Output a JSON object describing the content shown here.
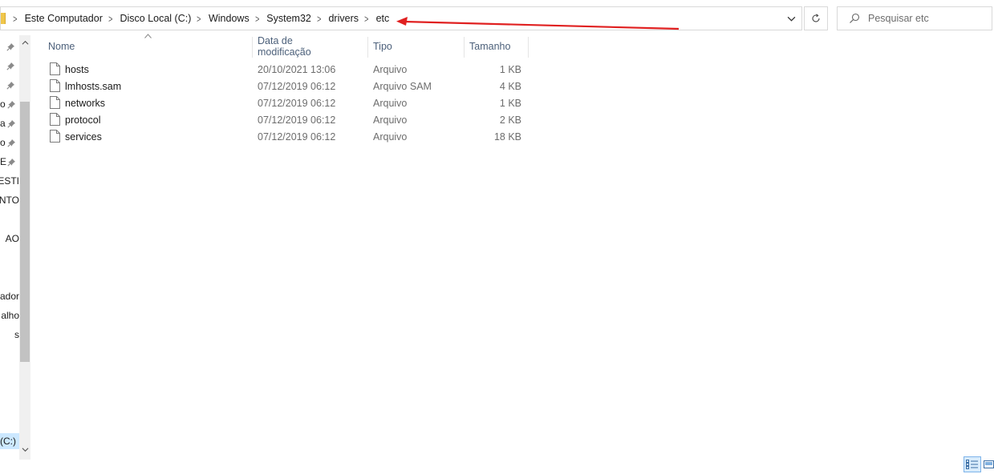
{
  "address_bar": {
    "breadcrumbs": [
      "Este Computador",
      "Disco Local (C:)",
      "Windows",
      "System32",
      "drivers",
      "etc"
    ]
  },
  "search": {
    "placeholder": "Pesquisar etc"
  },
  "nav_pane": {
    "items": [
      {
        "label": "",
        "pinned": true
      },
      {
        "label": "",
        "pinned": true
      },
      {
        "label": "",
        "pinned": true
      },
      {
        "label": "o",
        "pinned": true
      },
      {
        "label": "a",
        "pinned": true
      },
      {
        "label": "o",
        "pinned": true
      },
      {
        "label": "E",
        "pinned": true
      },
      {
        "label": "TESTI",
        "pinned": false
      },
      {
        "label": "ENTO",
        "pinned": false
      },
      {
        "label": "",
        "pinned": false
      },
      {
        "label": "AO",
        "pinned": false
      },
      {
        "label": "",
        "pinned": false
      },
      {
        "label": "",
        "pinned": false
      },
      {
        "label": "ador",
        "pinned": false
      },
      {
        "label": "alho",
        "pinned": false
      },
      {
        "label": "s",
        "pinned": false
      }
    ],
    "selected_label": "(C:)"
  },
  "columns": {
    "name": "Nome",
    "date": "Data de modificação",
    "type": "Tipo",
    "size": "Tamanho"
  },
  "files": [
    {
      "name": "hosts",
      "date": "20/10/2021 13:06",
      "type": "Arquivo",
      "size": "1 KB"
    },
    {
      "name": "lmhosts.sam",
      "date": "07/12/2019 06:12",
      "type": "Arquivo SAM",
      "size": "4 KB"
    },
    {
      "name": "networks",
      "date": "07/12/2019 06:12",
      "type": "Arquivo",
      "size": "1 KB"
    },
    {
      "name": "protocol",
      "date": "07/12/2019 06:12",
      "type": "Arquivo",
      "size": "2 KB"
    },
    {
      "name": "services",
      "date": "07/12/2019 06:12",
      "type": "Arquivo",
      "size": "18 KB"
    }
  ],
  "colors": {
    "annotation_arrow": "#e02020",
    "header_text": "#4c607a",
    "selection": "#cce8ff"
  },
  "icons": {
    "folder": "folder-icon",
    "dropdown": "chevron-down-icon",
    "refresh": "refresh-icon",
    "search": "search-icon",
    "file": "file-icon",
    "pin": "pin-icon"
  }
}
